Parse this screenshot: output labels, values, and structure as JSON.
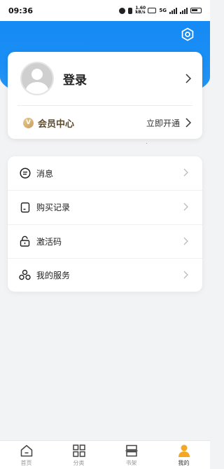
{
  "status_bar": {
    "time": "09:36",
    "speed": "1.60 kB/s",
    "network": "5G"
  },
  "profile": {
    "login_label": "登录",
    "member_label": "会员中心",
    "vip_badge": "V",
    "activate_label": "立即开通"
  },
  "menu": {
    "items": [
      {
        "label": "消息",
        "icon": "message-icon"
      },
      {
        "label": "购买记录",
        "icon": "purchase-record-icon"
      },
      {
        "label": "激活码",
        "icon": "lock-icon"
      },
      {
        "label": "我的服务",
        "icon": "services-icon"
      }
    ]
  },
  "tabs": [
    {
      "label": "首页",
      "icon": "home-icon",
      "active": false
    },
    {
      "label": "分类",
      "icon": "grid-icon",
      "active": false
    },
    {
      "label": "书架",
      "icon": "bookshelf-icon",
      "active": false
    },
    {
      "label": "我的",
      "icon": "person-icon",
      "active": true
    }
  ],
  "colors": {
    "header_blue": "#1487f5",
    "accent_orange": "#f5a623",
    "vip_gold": "#d4b06e"
  }
}
